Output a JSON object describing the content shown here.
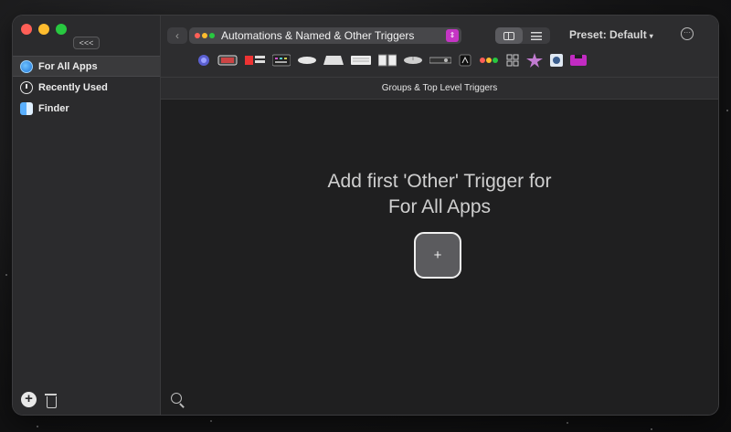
{
  "window": {
    "traffic_lights": [
      "close",
      "minimize",
      "zoom"
    ],
    "colors": {
      "close": "#ff5f57",
      "minimize": "#febc2e",
      "zoom": "#28c840"
    }
  },
  "sidebar": {
    "collapse_label": "<<<",
    "items": [
      {
        "label": "For All Apps",
        "icon": "globe-icon",
        "selected": true
      },
      {
        "label": "Recently Used",
        "icon": "clock-icon",
        "selected": false
      },
      {
        "label": "Finder",
        "icon": "finder-icon",
        "selected": false
      }
    ],
    "bottom_actions": [
      "add-icon",
      "trash-icon"
    ]
  },
  "toolbar": {
    "back_glyph": "‹",
    "trigger_type_label": "Automations & Named & Other Triggers",
    "chevron_glyph": "⌃⌄",
    "view_modes": [
      "columns-icon",
      "list-icon"
    ],
    "active_view": "columns-icon",
    "preset_label": "Preset: Default",
    "preset_caret": "▾",
    "more_glyph": "···",
    "trigger_category_icons": [
      "touchbar-circle-icon",
      "trackpad-icon",
      "macbook-touchbar-icon",
      "keyboard-shortcut-icon",
      "magic-mouse-icon",
      "magic-trackpad-icon",
      "keyboard-icon",
      "siri-remote-icon",
      "normal-mouse-icon",
      "apple-remote-icon",
      "stream-deck-icon",
      "automation-traffic-icon",
      "drawings-icon",
      "midi-icon",
      "bettertouch-icon",
      "notch-bar-icon"
    ]
  },
  "subheader": {
    "title": "Groups & Top Level Triggers"
  },
  "content": {
    "empty_line1": "Add first 'Other' Trigger for",
    "empty_line2": "For All Apps",
    "add_button_glyph": "+"
  },
  "accent_colors": {
    "chevron": "#c535c5",
    "selection": "#3a3a3c"
  }
}
